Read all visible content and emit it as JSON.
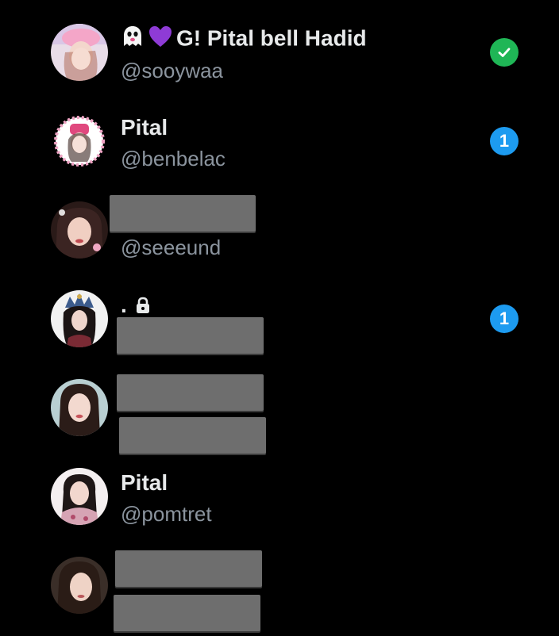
{
  "colors": {
    "background": "#000000",
    "name_text": "#e7e9ea",
    "handle_text": "#8b949e",
    "check_badge": "#1fb656",
    "count_badge": "#1d9bf0",
    "redaction": "#6e6e6e"
  },
  "accounts": [
    {
      "name": "G! Pital bell Hadid",
      "name_prefix_icons": [
        "ghost-icon",
        "purple-heart-icon"
      ],
      "handle": "@sooywaa",
      "status": "check-icon"
    },
    {
      "name": "Pital",
      "handle": "@benbelac",
      "badge_count": "1"
    },
    {
      "handle": "@seeeund",
      "name_redacted": true
    },
    {
      "name": ".",
      "name_suffix_icons": [
        "lock-icon"
      ],
      "handle_redacted": true,
      "badge_count": "1"
    },
    {
      "name_redacted": true,
      "handle_redacted": true
    },
    {
      "name": "Pital",
      "handle": "@pomtret"
    },
    {
      "name_redacted": true,
      "handle_redacted": true
    }
  ]
}
